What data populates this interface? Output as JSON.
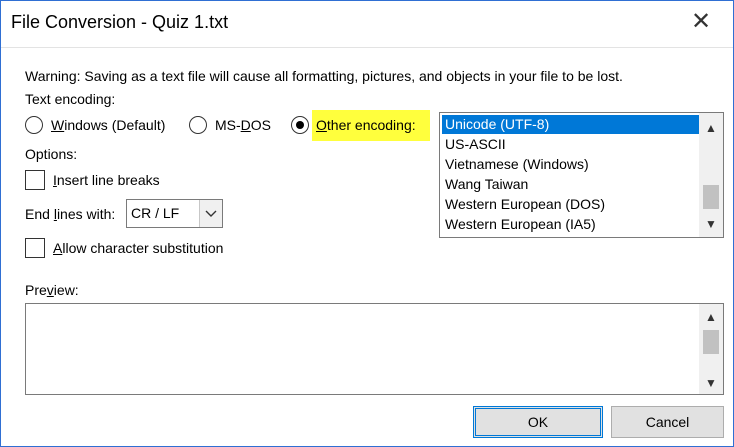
{
  "window": {
    "title": "File Conversion - Quiz 1.txt",
    "close_glyph": "✕"
  },
  "warning": "Warning: Saving as a text file will cause all formatting, pictures, and objects in your file to be lost.",
  "text_encoding": {
    "label": "Text encoding:",
    "options": [
      {
        "accel": "W",
        "rest": "indows (Default)",
        "selected": false
      },
      {
        "pre": "MS-",
        "accel": "D",
        "rest": "OS",
        "selected": false
      },
      {
        "accel": "O",
        "rest": "ther encoding:",
        "selected": true
      }
    ]
  },
  "encodings": {
    "items": [
      "Unicode (UTF-8)",
      "US-ASCII",
      "Vietnamese (Windows)",
      "Wang Taiwan",
      "Western European (DOS)",
      "Western European (IA5)"
    ],
    "selected_index": 0
  },
  "options": {
    "label": "Options:",
    "insert_line_breaks": {
      "accel": "I",
      "rest": "nsert line breaks",
      "checked": false
    },
    "end_lines": {
      "pre": "End ",
      "accel": "l",
      "rest": "ines with:",
      "value": "CR / LF"
    },
    "allow_substitution": {
      "accel": "A",
      "rest": "llow character substitution",
      "checked": false
    }
  },
  "preview": {
    "pre": "Pre",
    "accel": "v",
    "rest": "iew:"
  },
  "buttons": {
    "ok": "OK",
    "cancel": "Cancel"
  },
  "colors": {
    "accent": "#0078d7",
    "highlight": "#ffff3d",
    "border": "#2f6fd3"
  }
}
